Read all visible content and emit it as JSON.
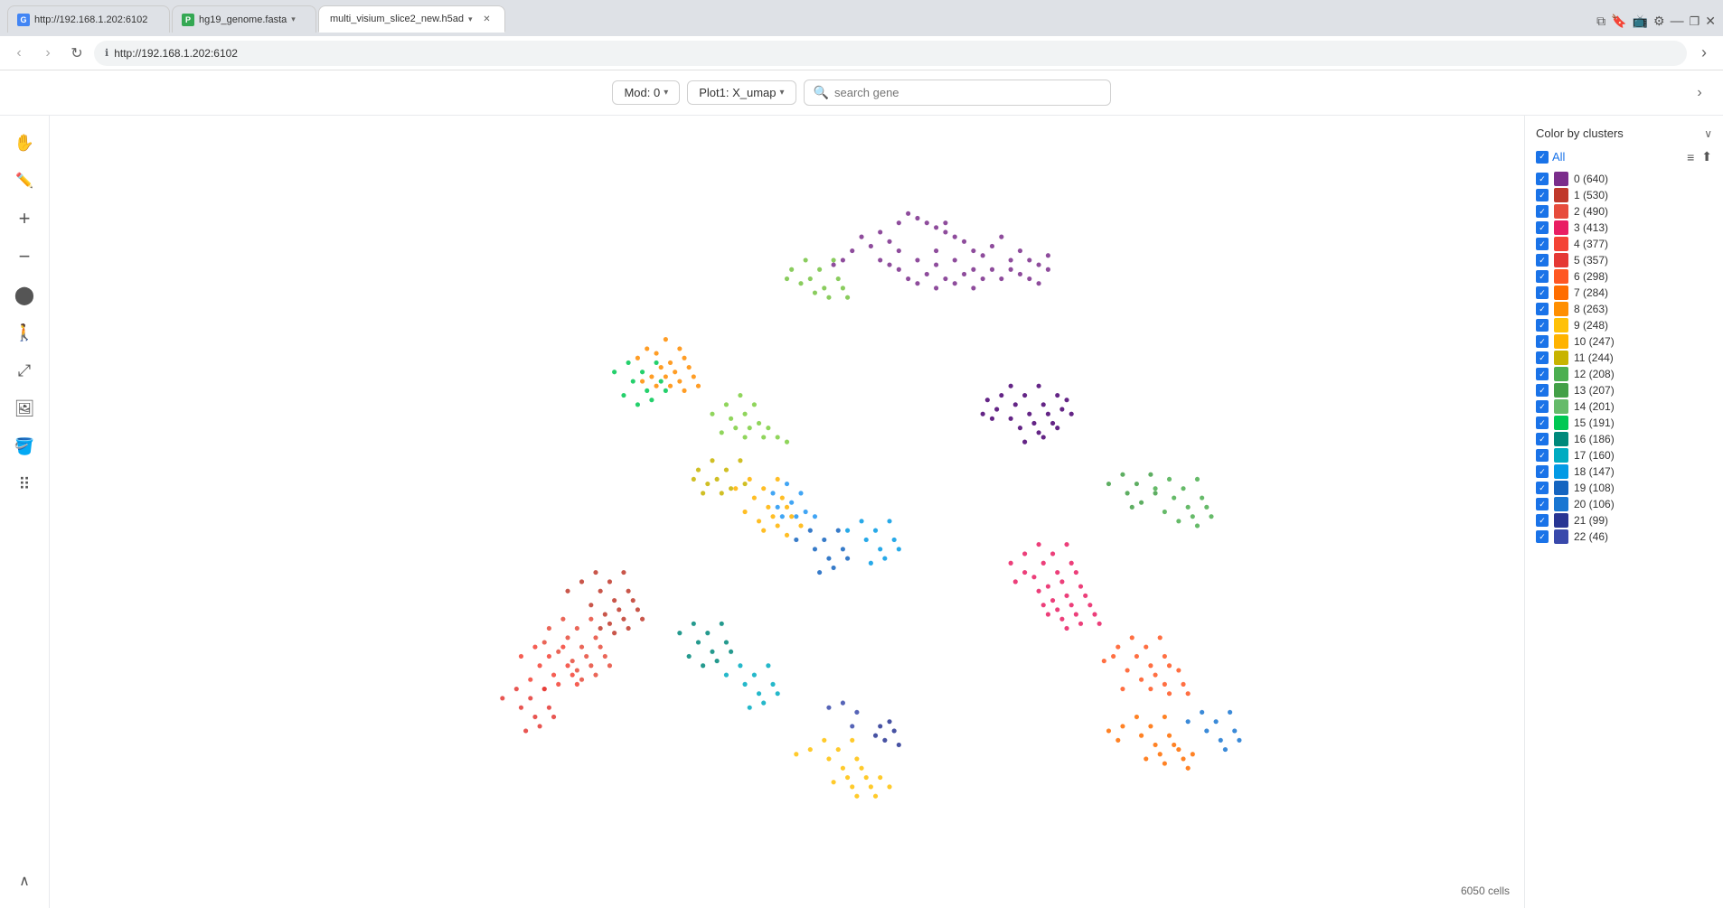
{
  "browser": {
    "tabs": [
      {
        "id": "tab1",
        "icon": "G",
        "icon_color": "#4285f4",
        "label": "http://192.168.1.202:6102",
        "active": false,
        "has_info": true
      },
      {
        "id": "tab2",
        "icon": "P",
        "icon_color": "#34a853",
        "label": "hg19_genome.fasta",
        "active": false,
        "has_dropdown": true
      },
      {
        "id": "tab3",
        "icon": "",
        "icon_color": "",
        "label": "multi_visium_slice2_new.h5ad",
        "active": true,
        "has_dropdown": true
      }
    ],
    "address": "http://192.168.1.202:6102"
  },
  "toolbar": {
    "mod_label": "Mod: 0",
    "plot_label": "Plot1: X_umap",
    "search_placeholder": "search gene"
  },
  "sidebar": {
    "icons": [
      {
        "name": "hand-tool",
        "symbol": "✋",
        "active": false
      },
      {
        "name": "edit-tool",
        "symbol": "✏️",
        "active": false
      },
      {
        "name": "add-tool",
        "symbol": "＋",
        "active": false
      },
      {
        "name": "subtract-tool",
        "symbol": "－",
        "active": false
      },
      {
        "name": "brush-tool",
        "symbol": "⬤",
        "active": false
      },
      {
        "name": "move-tool",
        "symbol": "🚶",
        "active": false
      },
      {
        "name": "zoom-tool",
        "symbol": "⤢",
        "active": false
      },
      {
        "name": "image-tool",
        "symbol": "🖼",
        "active": false
      },
      {
        "name": "paint-tool",
        "symbol": "🪣",
        "active": false
      },
      {
        "name": "dots-tool",
        "symbol": "⠿",
        "active": false
      }
    ],
    "bottom_icon": "∧"
  },
  "right_panel": {
    "title": "Color by clusters",
    "chevron": "∨",
    "all_label": "All",
    "clusters": [
      {
        "id": 0,
        "count": 640,
        "color": "#7b2d8b",
        "checked": true
      },
      {
        "id": 1,
        "count": 530,
        "color": "#c0392b",
        "checked": true
      },
      {
        "id": 2,
        "count": 490,
        "color": "#e74c3c",
        "checked": true
      },
      {
        "id": 3,
        "count": 413,
        "color": "#e91e63",
        "checked": true
      },
      {
        "id": 4,
        "count": 377,
        "color": "#f44336",
        "checked": true
      },
      {
        "id": 5,
        "count": 357,
        "color": "#e53935",
        "checked": true
      },
      {
        "id": 6,
        "count": 298,
        "color": "#ff5722",
        "checked": true
      },
      {
        "id": 7,
        "count": 284,
        "color": "#ff6d00",
        "checked": true
      },
      {
        "id": 8,
        "count": 263,
        "color": "#ff8f00",
        "checked": true
      },
      {
        "id": 9,
        "count": 248,
        "color": "#ffc107",
        "checked": true
      },
      {
        "id": 10,
        "count": 247,
        "color": "#ffb300",
        "checked": true
      },
      {
        "id": 11,
        "count": 244,
        "color": "#c8b400",
        "checked": true
      },
      {
        "id": 12,
        "count": 208,
        "color": "#4caf50",
        "checked": true
      },
      {
        "id": 13,
        "count": 207,
        "color": "#43a047",
        "checked": true
      },
      {
        "id": 14,
        "count": 201,
        "color": "#66bb6a",
        "checked": true
      },
      {
        "id": 15,
        "count": 191,
        "color": "#00c853",
        "checked": true
      },
      {
        "id": 16,
        "count": 186,
        "color": "#00897b",
        "checked": true
      },
      {
        "id": 17,
        "count": 160,
        "color": "#00acc1",
        "checked": true
      },
      {
        "id": 18,
        "count": 147,
        "color": "#039be5",
        "checked": true
      },
      {
        "id": 19,
        "count": 108,
        "color": "#1565c0",
        "checked": true
      },
      {
        "id": 20,
        "count": 106,
        "color": "#1976d2",
        "checked": true
      },
      {
        "id": 21,
        "count": 99,
        "color": "#283593",
        "checked": true
      },
      {
        "id": 22,
        "count": 46,
        "color": "#3949ab",
        "checked": true
      }
    ]
  },
  "plot": {
    "cell_count": "6050 cells"
  }
}
